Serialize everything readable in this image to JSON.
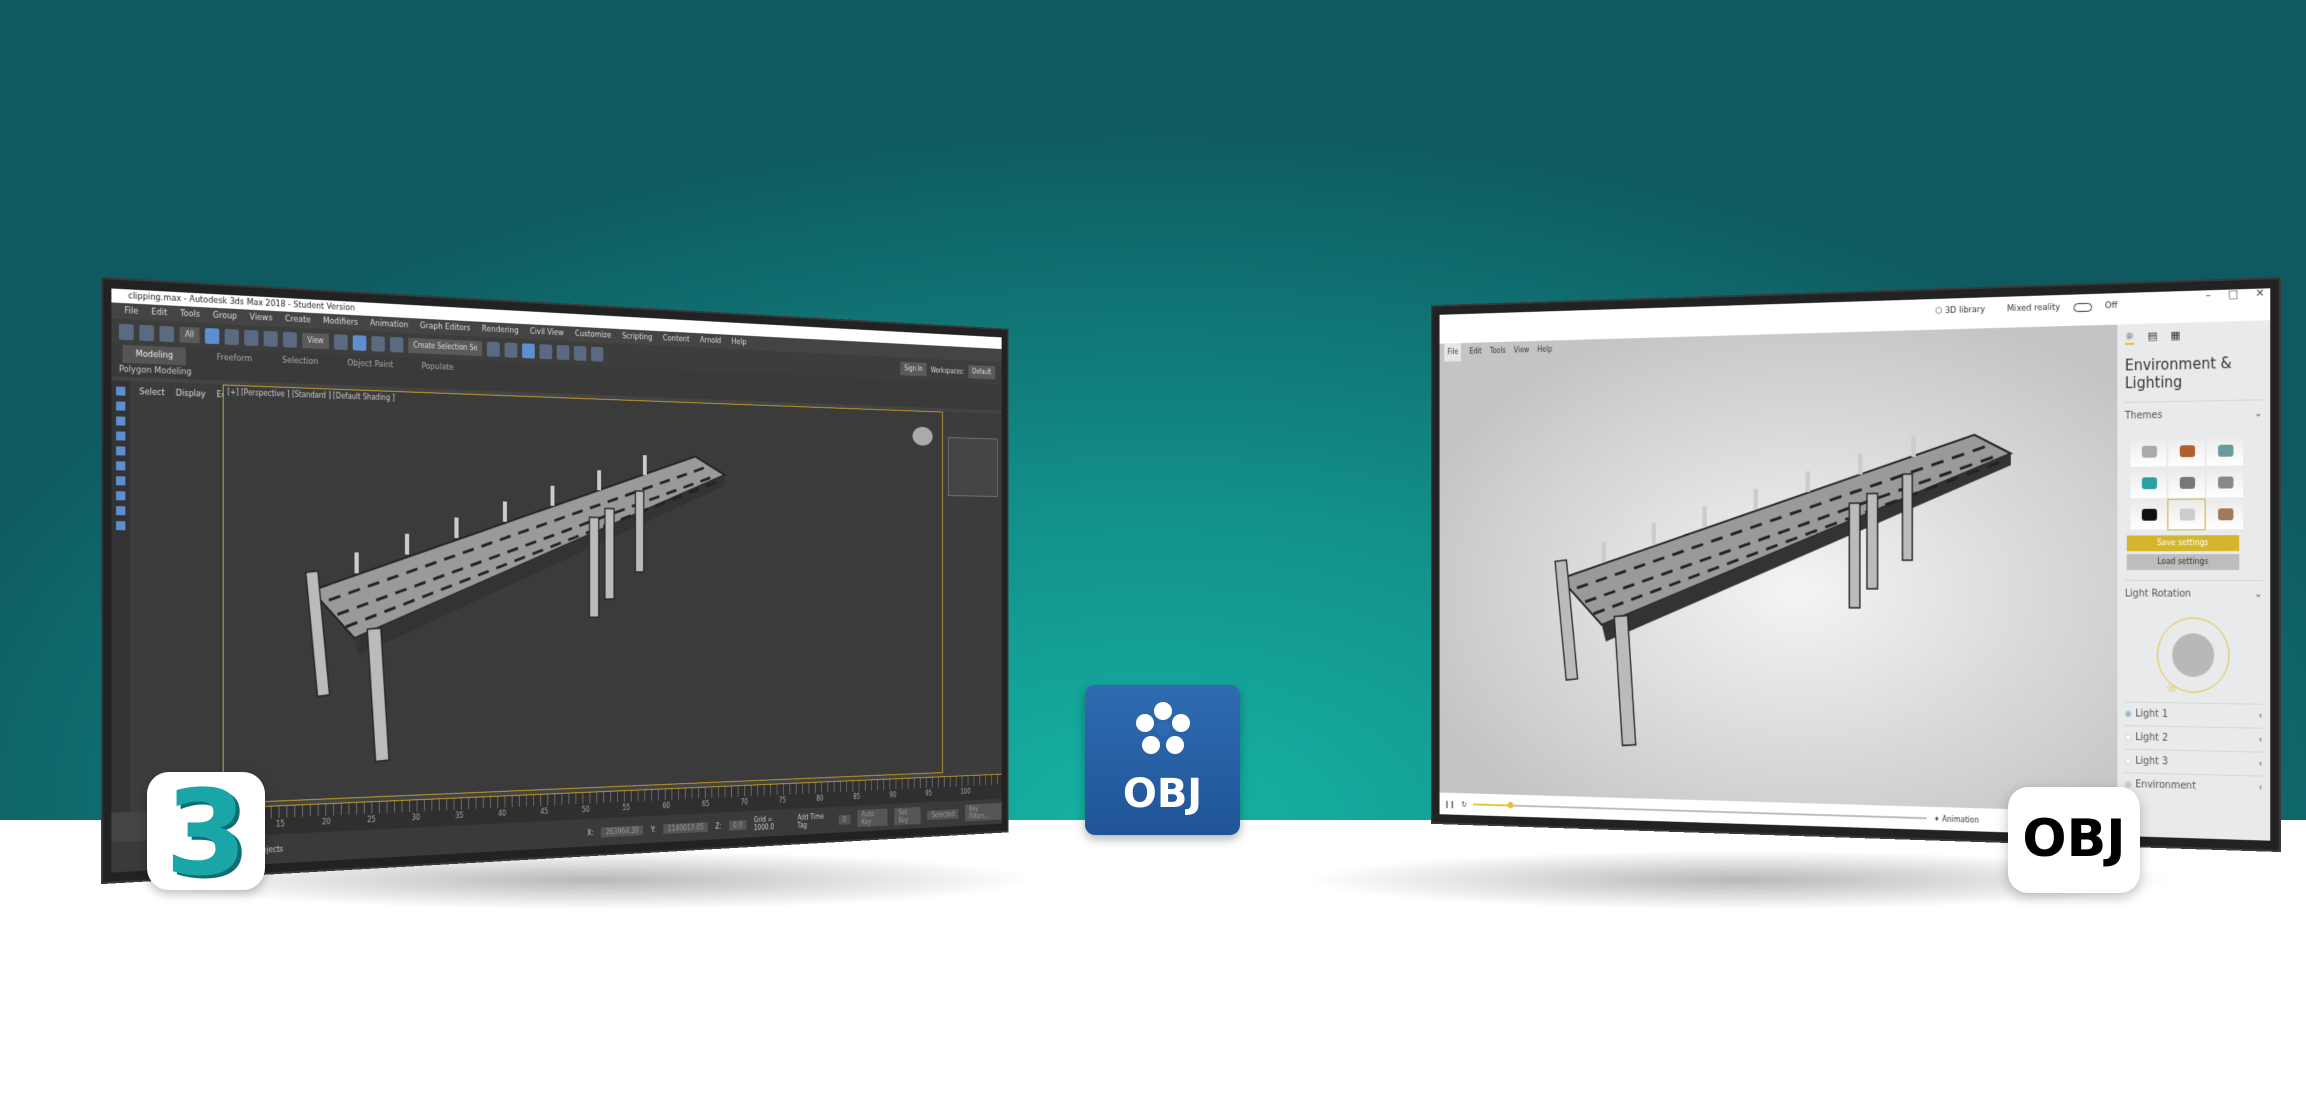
{
  "colors": {
    "teal": "#16b3a5",
    "max_accent": "#c9a02a",
    "viewer_accent": "#e0c23a",
    "obj_blue": "#2f6bb0"
  },
  "max": {
    "title": "clipping.max - Autodesk 3ds Max 2018 - Student Version",
    "menu": [
      "File",
      "Edit",
      "Tools",
      "Group",
      "Views",
      "Create",
      "Modifiers",
      "Animation",
      "Graph Editors",
      "Rendering",
      "Civil View",
      "Customize",
      "Scripting",
      "Content",
      "Arnold",
      "Help"
    ],
    "toolbar": {
      "filter": "All",
      "view": "View",
      "selection_set": "Create Selection Se",
      "sign_in": "Sign In",
      "workspaces_label": "Workspaces:",
      "workspace": "Default"
    },
    "ribbon_tabs": [
      "Modeling",
      "Freeform",
      "Selection",
      "Object Paint",
      "Populate"
    ],
    "ribbon_sub": "Polygon Modeling",
    "command_tabs": [
      "Select",
      "Display",
      "Edit"
    ],
    "viewport_label": "[+] [Perspective ] [Standard ] [Default Shading ]",
    "timeline_ticks": [
      "15",
      "20",
      "25",
      "30",
      "35",
      "40",
      "45",
      "50",
      "55",
      "60",
      "65",
      "70",
      "75",
      "80",
      "85",
      "90",
      "95",
      "100"
    ],
    "status": {
      "x": "263964.39",
      "y": "1140017.05",
      "z": "0.0",
      "grid": "Grid = 1000.0",
      "add_time_tag": "Add Time Tag",
      "frame": "0",
      "auto_key": "Auto Key",
      "set_key": "Set Key",
      "selected": "Selected",
      "key_filters": "Key Filters...",
      "objects": "Objects"
    }
  },
  "viewer": {
    "library": "3D library",
    "mixed_reality": "Mixed reality",
    "toggle": "Off",
    "menu": [
      "File",
      "Edit",
      "Tools",
      "View",
      "Help"
    ],
    "panel_title": "Environment & Lighting",
    "themes": "Themes",
    "save": "Save settings",
    "load": "Load settings",
    "light_rotation": "Light Rotation",
    "lights": [
      "Light 1",
      "Light 2",
      "Light 3",
      "Environment"
    ],
    "animation": "Animation"
  },
  "logos": {
    "max": "3",
    "obj_center": "OBJ",
    "obj_right": "OBJ"
  }
}
